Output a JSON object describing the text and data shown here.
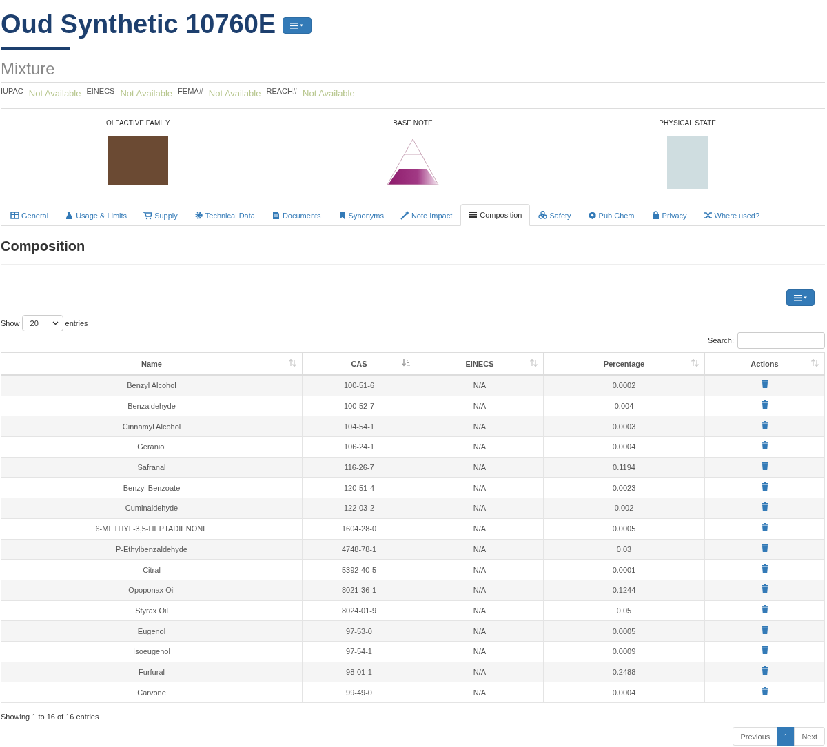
{
  "title": "Oud Synthetic 10760E",
  "subtitle": "Mixture",
  "identifiers": [
    {
      "label": "IUPAC",
      "value": "Not Available"
    },
    {
      "label": "EINECS",
      "value": "Not Available"
    },
    {
      "label": "FEMA#",
      "value": "Not Available"
    },
    {
      "label": "REACH#",
      "value": "Not Available"
    }
  ],
  "properties": [
    {
      "label": "OLFACTIVE FAMILY",
      "kind": "photo"
    },
    {
      "label": "BASE NOTE",
      "kind": "pyramid"
    },
    {
      "label": "PHYSICAL STATE",
      "kind": "photo"
    }
  ],
  "tabs": [
    {
      "label": "General",
      "selected": false
    },
    {
      "label": "Usage & Limits",
      "selected": false
    },
    {
      "label": "Supply",
      "selected": false
    },
    {
      "label": "Technical Data",
      "selected": false
    },
    {
      "label": "Documents",
      "selected": false
    },
    {
      "label": "Synonyms",
      "selected": false
    },
    {
      "label": "Note Impact",
      "selected": false
    },
    {
      "label": "Composition",
      "selected": true
    },
    {
      "label": "Safety",
      "selected": false
    },
    {
      "label": "Pub Chem",
      "selected": false
    },
    {
      "label": "Privacy",
      "selected": false
    },
    {
      "label": "Where used?",
      "selected": false
    }
  ],
  "section_title": "Composition",
  "length_menu": {
    "before": "Show",
    "value": "20",
    "after": "entries"
  },
  "search": {
    "label": "Search:"
  },
  "table": {
    "columns": [
      {
        "label": "Name",
        "sorted": false
      },
      {
        "label": "CAS",
        "sorted": true
      },
      {
        "label": "EINECS",
        "sorted": false
      },
      {
        "label": "Percentage",
        "sorted": false
      },
      {
        "label": "Actions",
        "sorted": false
      }
    ],
    "rows": [
      [
        "Benzyl Alcohol",
        "100-51-6",
        "N/A",
        "0.0002"
      ],
      [
        "Benzaldehyde",
        "100-52-7",
        "N/A",
        "0.004"
      ],
      [
        "Cinnamyl Alcohol",
        "104-54-1",
        "N/A",
        "0.0003"
      ],
      [
        "Geraniol",
        "106-24-1",
        "N/A",
        "0.0004"
      ],
      [
        "Safranal",
        "116-26-7",
        "N/A",
        "0.1194"
      ],
      [
        "Benzyl Benzoate",
        "120-51-4",
        "N/A",
        "0.0023"
      ],
      [
        "Cuminaldehyde",
        "122-03-2",
        "N/A",
        "0.002"
      ],
      [
        "6-METHYL-3,5-HEPTADIENONE",
        "1604-28-0",
        "N/A",
        "0.0005"
      ],
      [
        "P-Ethylbenzaldehyde",
        "4748-78-1",
        "N/A",
        "0.03"
      ],
      [
        "Citral",
        "5392-40-5",
        "N/A",
        "0.0001"
      ],
      [
        "Opoponax Oil",
        "8021-36-1",
        "N/A",
        "0.1244"
      ],
      [
        "Styrax Oil",
        "8024-01-9",
        "N/A",
        "0.05"
      ],
      [
        "Eugenol",
        "97-53-0",
        "N/A",
        "0.0005"
      ],
      [
        "Isoeugenol",
        "97-54-1",
        "N/A",
        "0.0009"
      ],
      [
        "Furfural",
        "98-01-1",
        "N/A",
        "0.2488"
      ],
      [
        "Carvone",
        "99-49-0",
        "N/A",
        "0.0004"
      ]
    ]
  },
  "info": "Showing 1 to 16 of 16 entries",
  "pagination": [
    {
      "label": "Previous",
      "selected": false
    },
    {
      "label": "1",
      "selected": true
    },
    {
      "label": "Next",
      "selected": false
    }
  ]
}
